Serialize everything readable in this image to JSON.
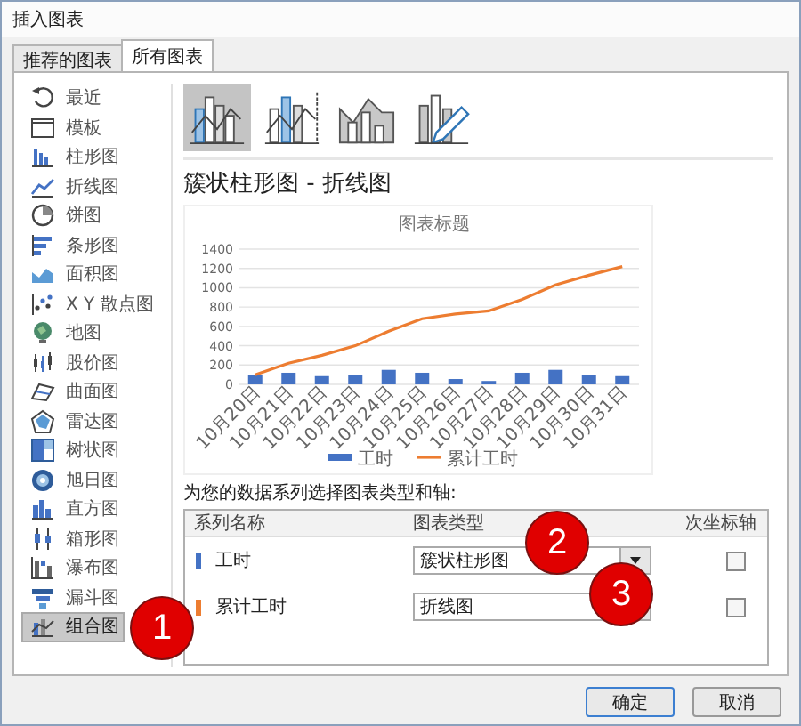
{
  "window": {
    "title": "插入图表"
  },
  "tabs": [
    {
      "label": "推荐的图表",
      "selected": false
    },
    {
      "label": "所有图表",
      "selected": true
    }
  ],
  "sidebar": {
    "items": [
      {
        "label": "最近",
        "kind": "recent",
        "selected": false
      },
      {
        "label": "模板",
        "kind": "template",
        "selected": false
      },
      {
        "label": "柱形图",
        "kind": "column",
        "selected": false
      },
      {
        "label": "折线图",
        "kind": "line",
        "selected": false
      },
      {
        "label": "饼图",
        "kind": "pie",
        "selected": false
      },
      {
        "label": "条形图",
        "kind": "bar",
        "selected": false
      },
      {
        "label": "面积图",
        "kind": "area",
        "selected": false
      },
      {
        "label": "X Y 散点图",
        "kind": "scatter",
        "selected": false
      },
      {
        "label": "地图",
        "kind": "map",
        "selected": false
      },
      {
        "label": "股价图",
        "kind": "stock",
        "selected": false
      },
      {
        "label": "曲面图",
        "kind": "surface",
        "selected": false
      },
      {
        "label": "雷达图",
        "kind": "radar",
        "selected": false
      },
      {
        "label": "树状图",
        "kind": "treemap",
        "selected": false
      },
      {
        "label": "旭日图",
        "kind": "sunburst",
        "selected": false
      },
      {
        "label": "直方图",
        "kind": "histogram",
        "selected": false
      },
      {
        "label": "箱形图",
        "kind": "boxplot",
        "selected": false
      },
      {
        "label": "瀑布图",
        "kind": "waterfall",
        "selected": false
      },
      {
        "label": "漏斗图",
        "kind": "funnel",
        "selected": false
      },
      {
        "label": "组合图",
        "kind": "combo",
        "selected": true
      }
    ]
  },
  "subtypes": [
    {
      "kind": "column-line",
      "selected": true
    },
    {
      "kind": "column-line-secondary",
      "selected": false
    },
    {
      "kind": "area-column",
      "selected": false
    },
    {
      "kind": "custom",
      "selected": false
    }
  ],
  "heading": "簇状柱形图 - 折线图",
  "preview": {
    "chart_data": {
      "type": "bar",
      "title": "图表标题",
      "categories": [
        "10月20日",
        "10月21日",
        "10月22日",
        "10月23日",
        "10月24日",
        "10月25日",
        "10月26日",
        "10月27日",
        "10月28日",
        "10月29日",
        "10月30日",
        "10月31日"
      ],
      "series": [
        {
          "name": "工时",
          "type": "bar",
          "color": "#4472c4",
          "values": [
            100,
            120,
            85,
            100,
            150,
            120,
            55,
            35,
            120,
            150,
            100,
            85
          ]
        },
        {
          "name": "累计工时",
          "type": "line",
          "color": "#ed7d31",
          "values": [
            100,
            220,
            300,
            400,
            550,
            680,
            730,
            760,
            880,
            1030,
            1130,
            1220
          ]
        }
      ],
      "grid": true,
      "legend": "bottom",
      "ylim": [
        0,
        1400
      ],
      "yticks": [
        0,
        200,
        400,
        600,
        800,
        1000,
        1200,
        1400
      ]
    }
  },
  "series_prompt": "为您的数据系列选择图表类型和轴:",
  "series_table": {
    "columns": [
      "系列名称",
      "图表类型",
      "次坐标轴"
    ],
    "rows": [
      {
        "name": "工时",
        "color": "#4472c4",
        "chart_type": "簇状柱形图",
        "secondary_axis": false
      },
      {
        "name": "累计工时",
        "color": "#ed7d31",
        "chart_type": "折线图",
        "secondary_axis": false
      }
    ]
  },
  "markers": [
    "1",
    "2",
    "3"
  ],
  "buttons": [
    {
      "label": "确定",
      "default": true
    },
    {
      "label": "取消",
      "default": false
    }
  ]
}
